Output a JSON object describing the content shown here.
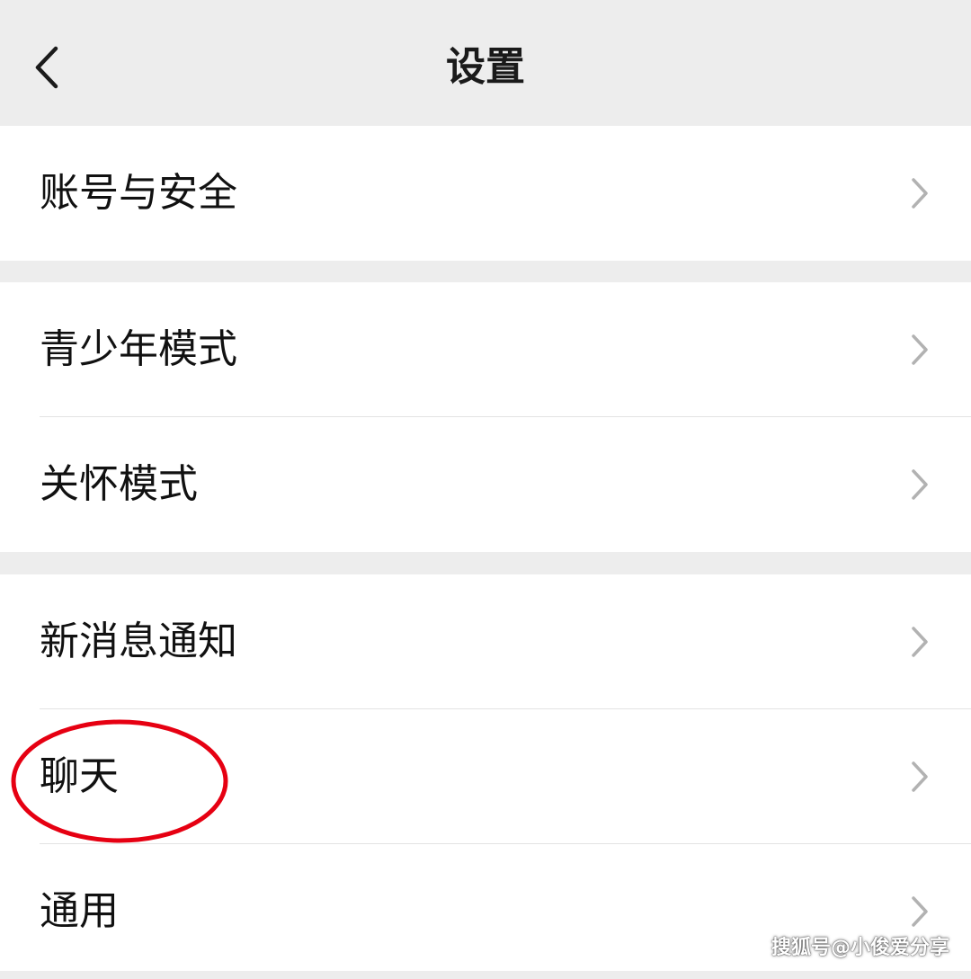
{
  "header": {
    "title": "设置",
    "back_icon": "chevron-left-icon"
  },
  "groups": [
    {
      "items": [
        {
          "label": "账号与安全"
        }
      ]
    },
    {
      "items": [
        {
          "label": "青少年模式"
        },
        {
          "label": "关怀模式"
        }
      ]
    },
    {
      "items": [
        {
          "label": "新消息通知"
        },
        {
          "label": "聊天"
        },
        {
          "label": "通用"
        }
      ]
    }
  ],
  "annotation": {
    "target": "聊天",
    "color": "#e60012"
  },
  "watermark": {
    "text": "搜狐号@小俊爱分享"
  },
  "colors": {
    "background": "#ededed",
    "card": "#ffffff",
    "text": "#111111",
    "chevron": "#b2b2b2"
  }
}
